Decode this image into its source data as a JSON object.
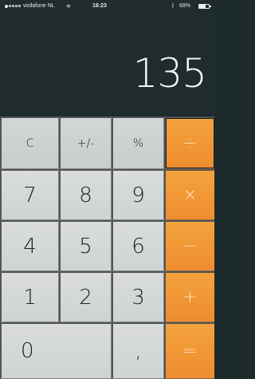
{
  "status_bar": {
    "carrier": "vodafone NL",
    "time": "16:23",
    "battery_percent": "69%",
    "battery_level": 0.69,
    "wifi_icon": "wifi-icon",
    "bluetooth_icon": "bluetooth-icon"
  },
  "display": {
    "value": "135"
  },
  "keys": {
    "clear": "C",
    "plus_minus": "+/-",
    "percent": "%",
    "divide": "÷",
    "seven": "7",
    "eight": "8",
    "nine": "9",
    "multiply": "×",
    "four": "4",
    "five": "5",
    "six": "6",
    "minus": "−",
    "one": "1",
    "two": "2",
    "three": "3",
    "plus": "+",
    "zero": "0",
    "decimal": ",",
    "equals": "="
  },
  "colors": {
    "display_background": "#1f2b2c",
    "operator_orange": "#f39a37",
    "number_key_gray": "#d6d9d9"
  }
}
